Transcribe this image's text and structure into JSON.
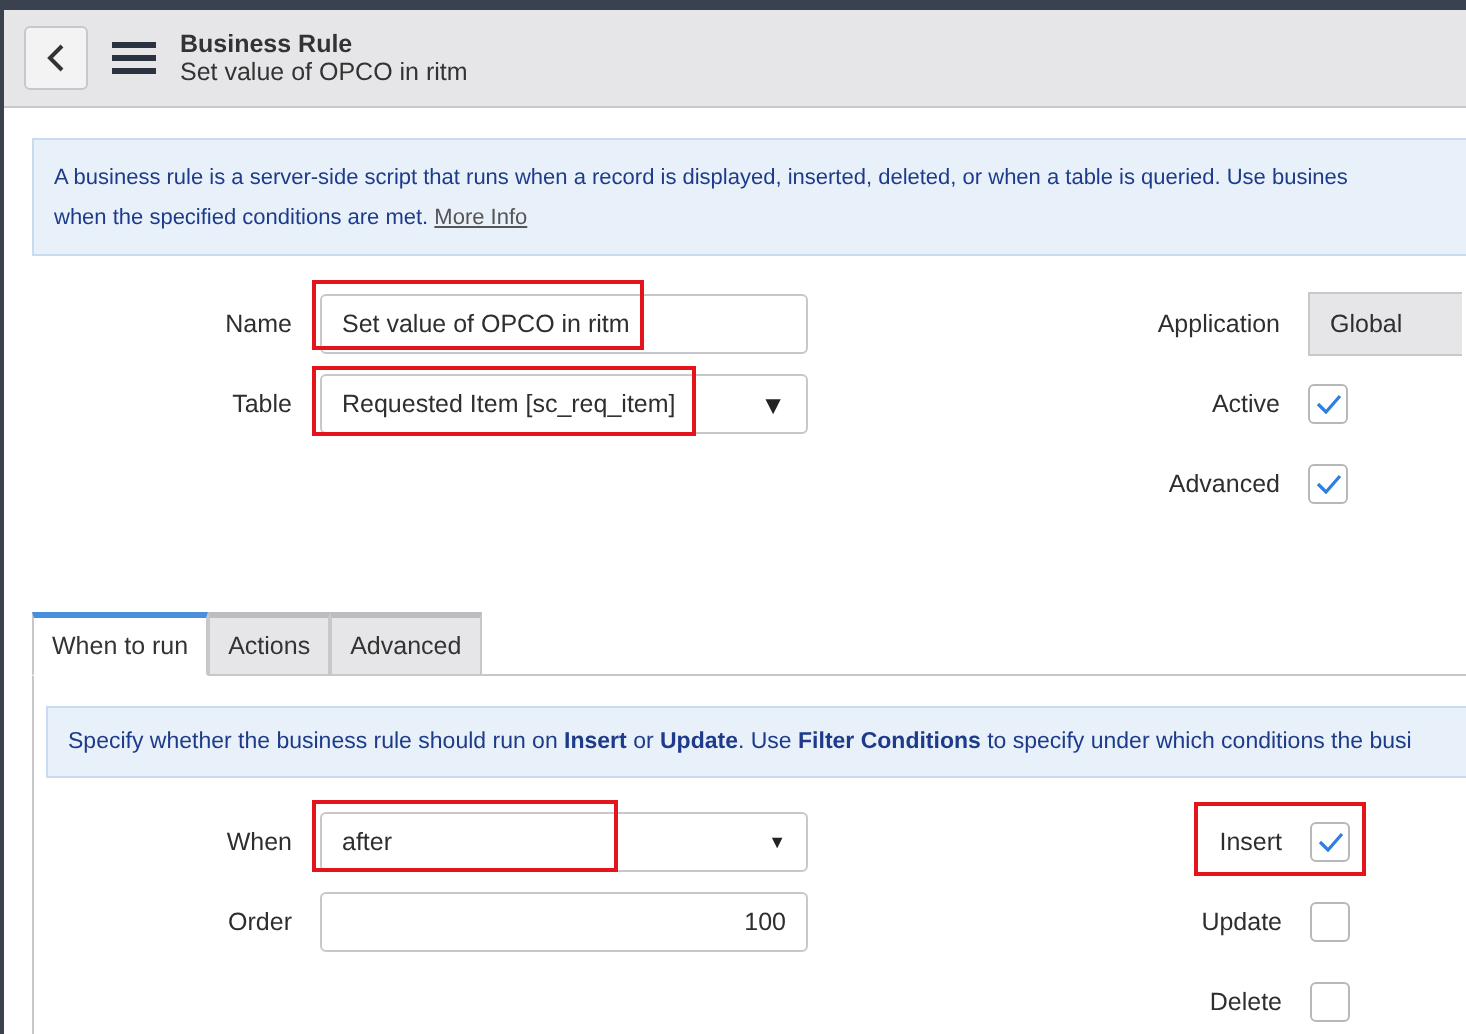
{
  "header": {
    "title": "Business Rule",
    "subtitle": "Set value of OPCO in ritm"
  },
  "intro": {
    "line_1": "A business rule is a server-side script that runs when a record is displayed, inserted, deleted, or when a table is queried. Use busines",
    "line_2": "when the specified conditions are met.",
    "link": "More Info"
  },
  "form_left": [
    {
      "label": "Name",
      "kind": "text",
      "value": "Set value of OPCO in ritm",
      "highlighted": true
    },
    {
      "label": "Table",
      "kind": "select",
      "value": "Requested Item [sc_req_item]",
      "caret": "▼",
      "highlighted": true
    }
  ],
  "form_right": [
    {
      "label": "Application",
      "kind": "readonly",
      "value": "Global"
    },
    {
      "label": "Active",
      "kind": "checkbox",
      "checked": true
    },
    {
      "label": "Advanced",
      "kind": "checkbox",
      "checked": true
    }
  ],
  "tabs": [
    {
      "label": "When to run",
      "selected": true
    },
    {
      "label": "Actions",
      "selected": false
    },
    {
      "label": "Advanced",
      "selected": false
    }
  ],
  "tab_info": "Specify whether the business rule should run on **Insert** or **Update**. Use **Filter Conditions** to specify under which conditions the busi",
  "when_left": [
    {
      "label": "When",
      "kind": "select",
      "value": "after",
      "caret": "▼",
      "highlighted": true
    },
    {
      "label": "Order",
      "kind": "number",
      "value": "100",
      "highlighted": false
    }
  ],
  "when_right": [
    {
      "label": "Insert",
      "kind": "checkbox",
      "checked": true,
      "highlighted": true
    },
    {
      "label": "Update",
      "kind": "checkbox",
      "checked": false,
      "highlighted": false
    },
    {
      "label": "Delete",
      "kind": "checkbox",
      "checked": false,
      "highlighted": false
    }
  ]
}
